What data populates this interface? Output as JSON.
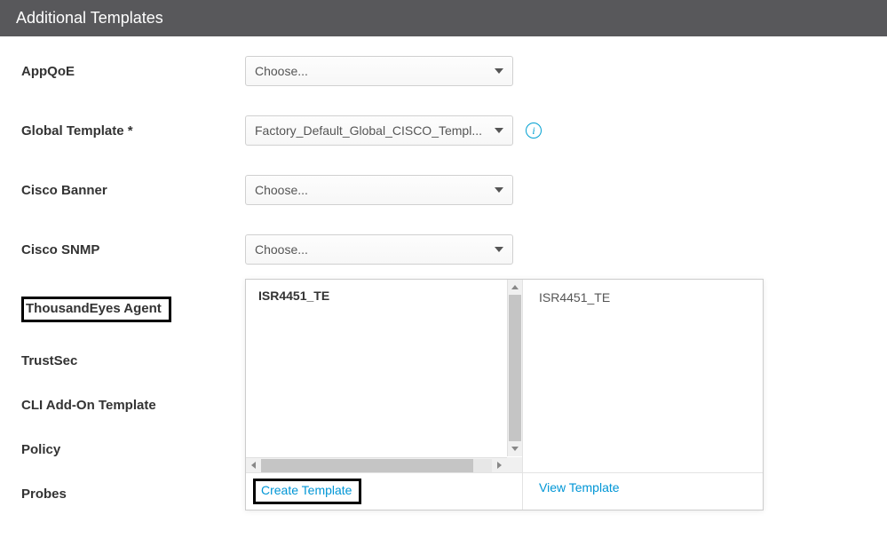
{
  "header": {
    "title": "Additional Templates"
  },
  "placeholders": {
    "choose": "Choose..."
  },
  "fields": {
    "appqoe": {
      "label": "AppQoE"
    },
    "global_template": {
      "label": "Global Template *",
      "value": "Factory_Default_Global_CISCO_Templ..."
    },
    "cisco_banner": {
      "label": "Cisco Banner"
    },
    "cisco_snmp": {
      "label": "Cisco SNMP"
    },
    "thousandeyes": {
      "label": "ThousandEyes Agent"
    },
    "trustsec": {
      "label": "TrustSec"
    },
    "cli_addon": {
      "label": "CLI Add-On Template"
    },
    "policy": {
      "label": "Policy"
    },
    "probes": {
      "label": "Probes"
    }
  },
  "dropdown": {
    "options": [
      "ISR4451_TE"
    ],
    "preview_title": "ISR4451_TE",
    "create_label": "Create Template",
    "view_label": "View Template"
  }
}
